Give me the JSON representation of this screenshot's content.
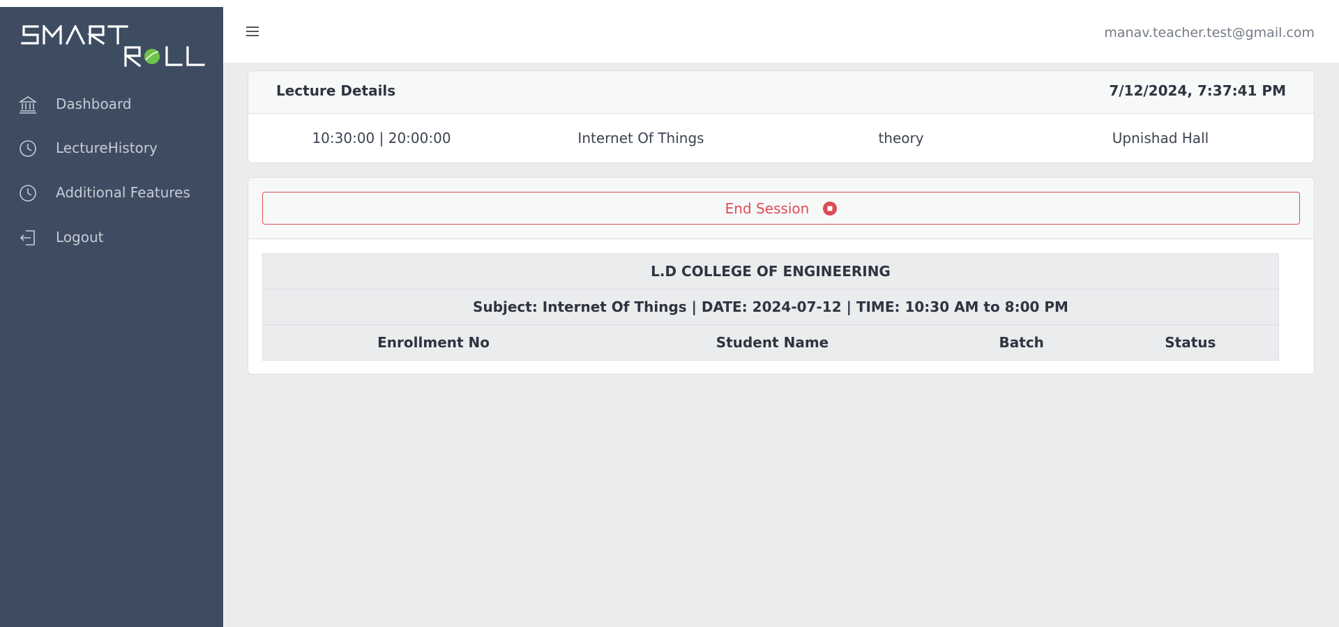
{
  "app": {
    "logo_text": "SMART ROLL",
    "brand_accent": "#6fc34a"
  },
  "sidebar": {
    "items": [
      {
        "label": "Dashboard",
        "icon": "bank-icon"
      },
      {
        "label": "LectureHistory",
        "icon": "clock-icon"
      },
      {
        "label": "Additional Features",
        "icon": "clock-icon"
      },
      {
        "label": "Logout",
        "icon": "logout-icon"
      }
    ]
  },
  "header": {
    "user_email": "manav.teacher.test@gmail.com"
  },
  "lecture": {
    "title": "Lecture Details",
    "timestamp": "7/12/2024, 7:37:41 PM",
    "time_range": "10:30:00 | 20:00:00",
    "subject": "Internet Of Things",
    "type": "theory",
    "venue": "Upnishad Hall"
  },
  "session": {
    "end_label": "End Session",
    "end_color": "#dc4c55"
  },
  "attendance": {
    "college": "L.D COLLEGE OF ENGINEERING",
    "info": "Subject: Internet Of Things | DATE: 2024-07-12 | TIME: 10:30 AM to 8:00 PM",
    "columns": [
      "Enrollment No",
      "Student Name",
      "Batch",
      "Status"
    ]
  }
}
